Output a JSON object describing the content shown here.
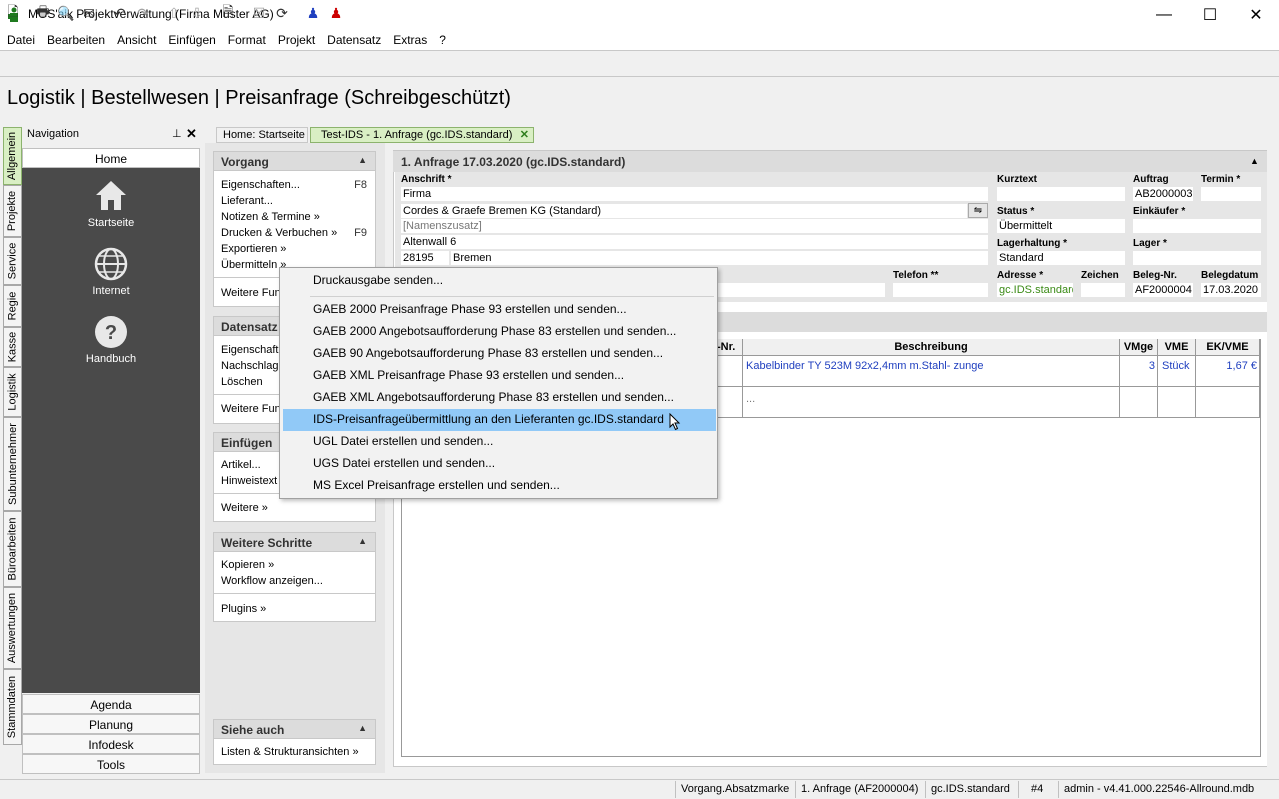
{
  "window": {
    "title": "MOS'aik Projektverwaltung (Firma Muster AG)",
    "minimize": "—",
    "maximize": "☐",
    "close": "✕"
  },
  "menu": [
    "Datei",
    "Bearbeiten",
    "Ansicht",
    "Einfügen",
    "Format",
    "Projekt",
    "Datensatz",
    "Extras",
    "?"
  ],
  "header": {
    "title": "Logistik | Bestellwesen | Preisanfrage (Schreibgeschützt)"
  },
  "vtabs": [
    "Allgemein",
    "Projekte",
    "Service",
    "Regie",
    "Kasse",
    "Logistik",
    "Subunternehmer",
    "Büroarbeiten",
    "Auswertungen",
    "Stammdaten"
  ],
  "navigation": {
    "title": "Navigation",
    "pin": "⊥",
    "close": "✕",
    "home": "Home",
    "tiles": [
      {
        "label": "Startseite",
        "icon": "house-icon"
      },
      {
        "label": "Internet",
        "icon": "globe-icon"
      },
      {
        "label": "Handbuch",
        "icon": "help-icon"
      }
    ],
    "bottom": [
      "Agenda",
      "Planung",
      "Infodesk",
      "Tools"
    ]
  },
  "tabs": {
    "home": "Home: Startseite",
    "doc": "Test-IDS - 1. Anfrage (gc.IDS.standard)",
    "doc_close": "✕"
  },
  "actions": {
    "vorgang": {
      "title": "Vorgang",
      "items": [
        {
          "label": "Eigenschaften...",
          "key": "F8"
        },
        {
          "label": "Lieferant...",
          "key": ""
        },
        {
          "label": "Notizen & Termine »",
          "key": ""
        },
        {
          "label": "Drucken & Verbuchen »",
          "key": "F9"
        },
        {
          "label": "Exportieren »",
          "key": ""
        },
        {
          "label": "Übermitteln »",
          "key": ""
        }
      ],
      "more": "Weitere Fun"
    },
    "datensatz": {
      "title": "Datensatz",
      "items": [
        "Eigenschafte",
        "Nachschlage",
        "Löschen"
      ],
      "more": "Weitere Fun"
    },
    "einfuegen": {
      "title": "Einfügen",
      "items": [
        "Artikel...",
        "Hinweistext"
      ],
      "more": "Weitere »"
    },
    "weitere": {
      "title": "Weitere Schritte",
      "items": [
        "Kopieren »",
        "Workflow anzeigen..."
      ],
      "more": "Plugins »"
    },
    "siehe": {
      "title": "Siehe auch",
      "items": [
        "Listen & Strukturansichten »"
      ]
    }
  },
  "doc": {
    "title": "1. Anfrage 17.03.2020 (gc.IDS.standard)",
    "anschrift_label": "Anschrift *",
    "anschrift": [
      "Firma",
      "Cordes & Graefe Bremen KG (Standard)",
      "[Namenszusatz]",
      "Altenwall 6"
    ],
    "plz": "28195",
    "ort": "Bremen",
    "telefon_label": "Telefon **",
    "kurztext_label": "Kurztext",
    "auftrag_label": "Auftrag",
    "auftrag": "AB2000003",
    "termin_label": "Termin *",
    "status_label": "Status *",
    "status": "Übermittelt",
    "einkaeufer_label": "Einkäufer *",
    "lagerhaltung_label": "Lagerhaltung *",
    "lagerhaltung": "Standard",
    "lager_label": "Lager *",
    "adresse_label": "Adresse *",
    "adresse": "gc.IDS.standard",
    "zeichen_label": "Zeichen",
    "belegnr_label": "Beleg-Nr.",
    "belegnr": "AF2000004",
    "belegdatum_label": "Belegdatum",
    "belegdatum": "17.03.2020"
  },
  "table": {
    "columns": [
      "-Nr.",
      "Beschreibung",
      "VMge",
      "VME",
      "EK/VME"
    ],
    "rows": [
      {
        "beschreibung": "Kabelbinder TY 523M 92x2,4mm m.Stahl- zunge",
        "vmge": "3",
        "vme": "Stück",
        "ek": "1,67 €"
      },
      {
        "beschreibung": "...",
        "vmge": "",
        "vme": "",
        "ek": ""
      }
    ]
  },
  "popup": {
    "items": [
      "Druckausgabe senden...",
      "GAEB 2000 Preisanfrage Phase 93 erstellen und senden...",
      "GAEB 2000 Angebotsaufforderung Phase 83 erstellen und senden...",
      "GAEB 90 Angebotsaufforderung Phase 83 erstellen und senden...",
      "GAEB XML Preisanfrage Phase 93 erstellen und senden...",
      "GAEB XML Angebotsaufforderung Phase 83 erstellen und senden...",
      "IDS-Preisanfrageübermittlung an den Lieferanten gc.IDS.standard",
      "UGL Datei erstellen und senden...",
      "UGS Datei erstellen und senden...",
      "MS Excel Preisanfrage erstellen und senden..."
    ],
    "highlighted_index": 6
  },
  "status": [
    "Vorgang.Absatzmarke",
    "1. Anfrage (AF2000004)",
    "gc.IDS.standard",
    "#4",
    "admin - v4.41.000.22546-Allround.mdb"
  ],
  "colors": {
    "accent_green": "#d9efc4",
    "highlight_blue": "#91c9f7",
    "link_blue": "#1f3fbf"
  }
}
